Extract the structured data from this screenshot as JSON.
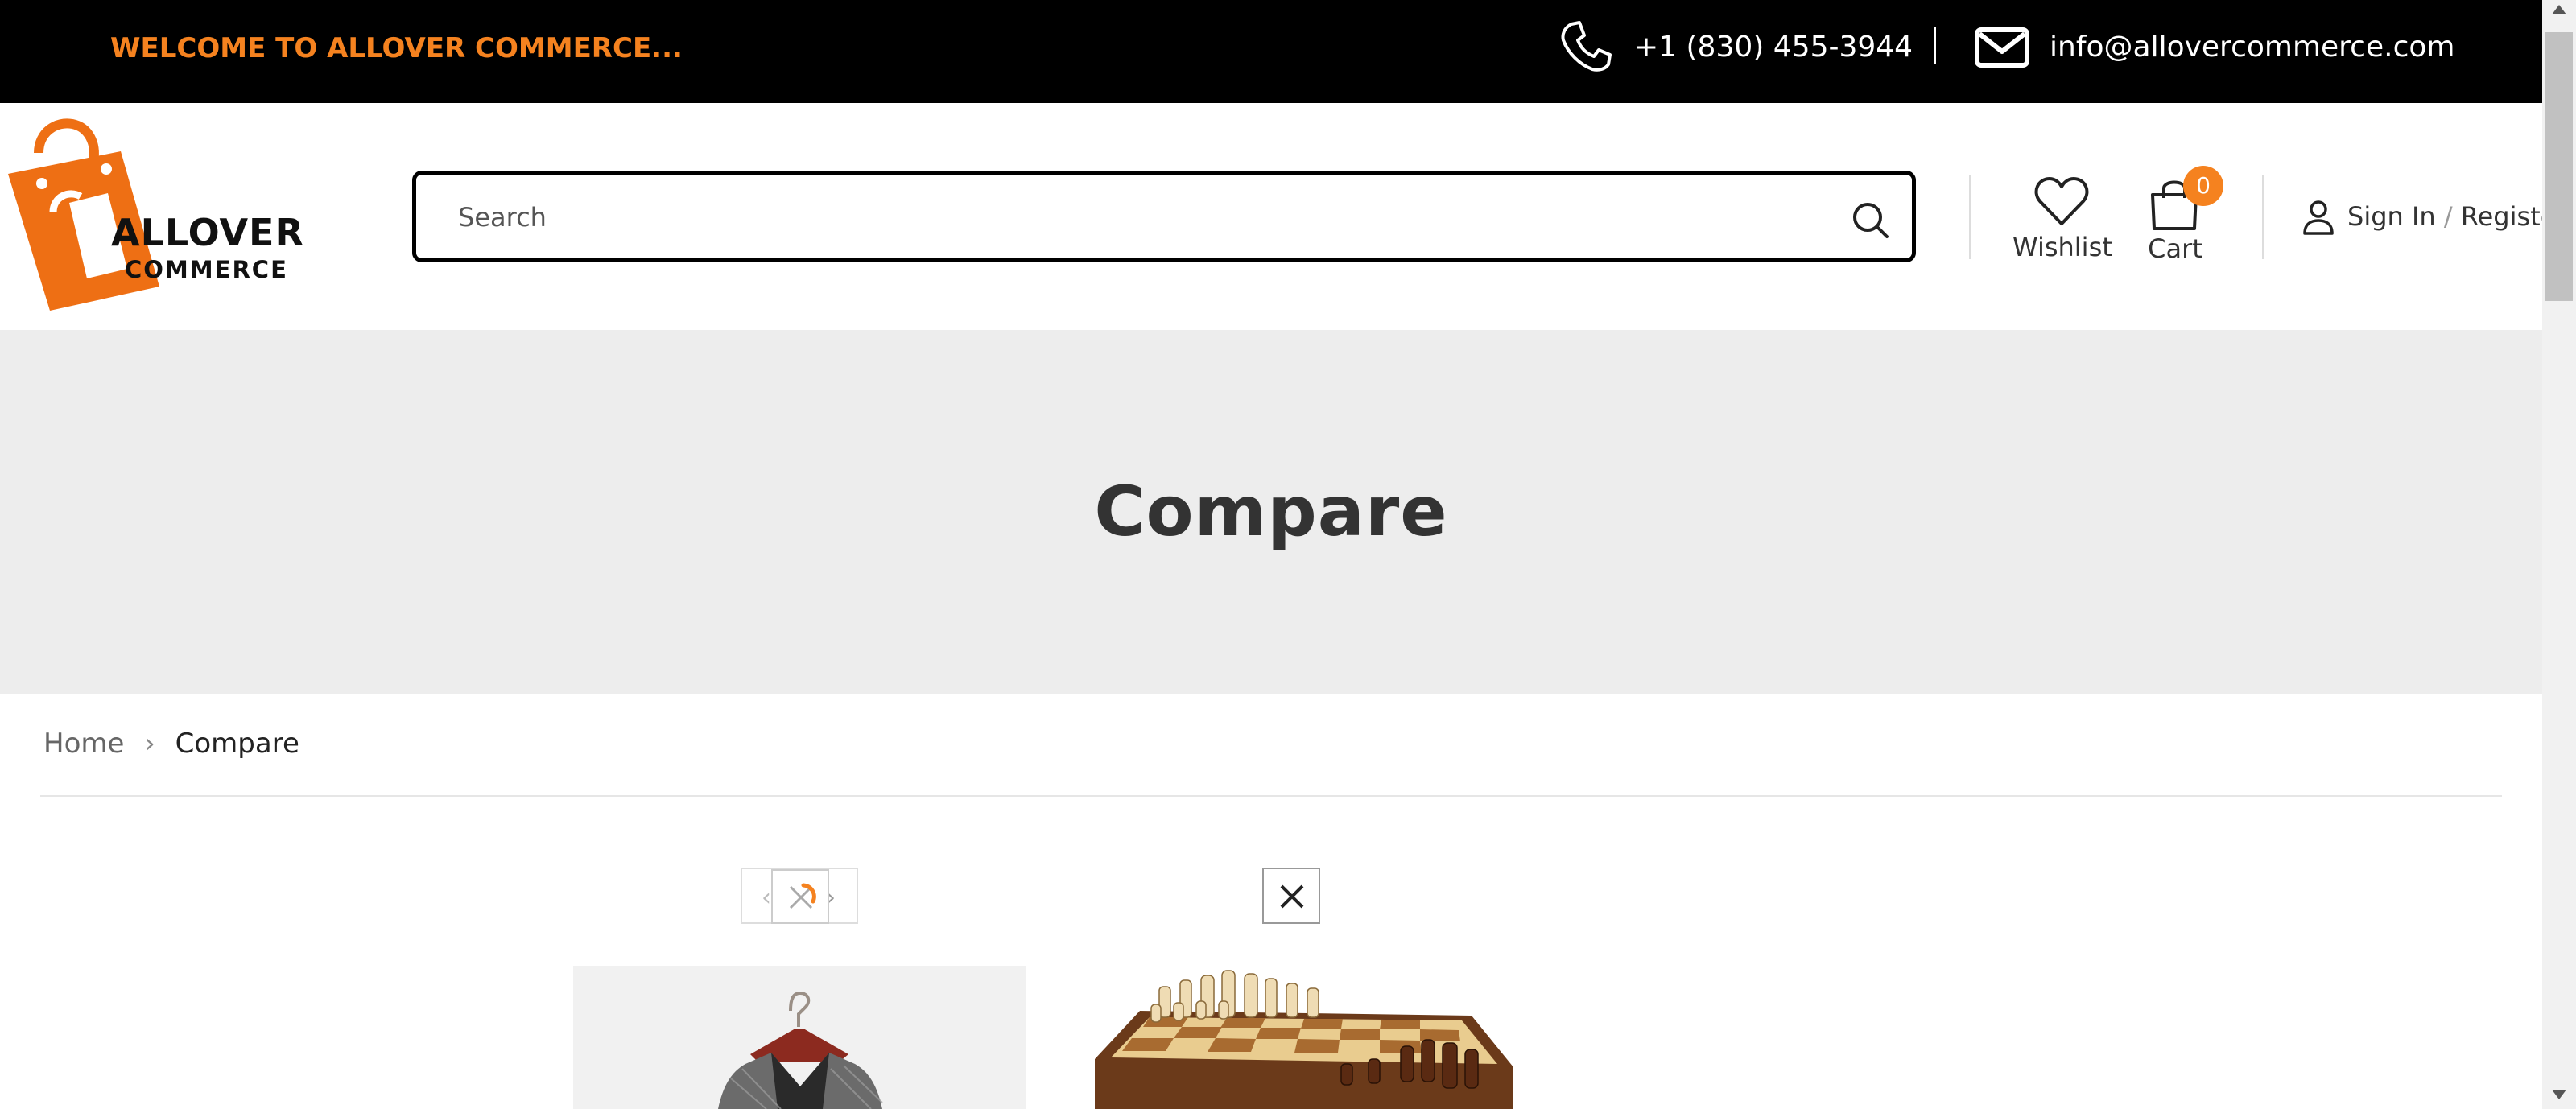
{
  "topbar": {
    "welcome": "WELCOME TO ALLOVER COMMERCE...",
    "phone": "+1 (830) 455-3944",
    "email": "info@allovercommerce.com",
    "phone_icon": "phone-icon",
    "email_icon": "envelope-icon"
  },
  "logo": {
    "line1": "ALLOVER",
    "line2": "COMMERCE"
  },
  "search": {
    "placeholder": "Search",
    "icon": "search-icon"
  },
  "header_actions": {
    "wishlist_label": "Wishlist",
    "cart_label": "Cart",
    "cart_count": "0",
    "sign_in": "Sign In",
    "separator": "/",
    "register": "Register"
  },
  "banner": {
    "title": "Compare"
  },
  "breadcrumb": {
    "home": "Home",
    "arrow": "›",
    "current": "Compare"
  },
  "products": {
    "prev_arrow": "‹",
    "next_arrow": "›"
  },
  "colors": {
    "accent": "#f5821f",
    "topbar_bg": "#000000",
    "banner_bg": "#ededed"
  }
}
